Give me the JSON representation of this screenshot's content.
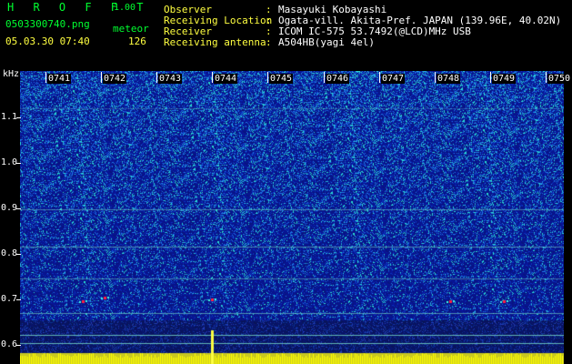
{
  "header": {
    "app_title": "H R O F F T",
    "version": "1.00",
    "filename": "0503300740.png",
    "mode_label": "meteor",
    "datetime": "05.03.30 07:40",
    "count": "126"
  },
  "station": [
    {
      "key": "Observer",
      "value": "Masayuki Kobayashi"
    },
    {
      "key": "Receiving Location",
      "value": "Ogata-vill. Akita-Pref. JAPAN (139.96E, 40.02N)"
    },
    {
      "key": "Receiver",
      "value": "ICOM IC-575 53.7492(@LCD)MHz USB"
    },
    {
      "key": "Receiving antenna",
      "value": "A504HB(yagi 4el)"
    }
  ],
  "separator": ":",
  "axis": {
    "y_unit": "kHz",
    "y_ticks": [
      "1.1",
      "1.0",
      "0.9",
      "0.8",
      "0.7",
      "0.6"
    ],
    "time_ticks": [
      "0741",
      "0742",
      "0743",
      "0744",
      "0745",
      "0746",
      "0747",
      "0748",
      "0749",
      "0750"
    ]
  },
  "colors": {
    "background": "#000000",
    "spectrum_base": "#0a1a9a",
    "noise_cyan": "#20d0d0",
    "header_green": "#00ff30",
    "header_yellow": "#ffff40",
    "signal_yellow": "#ffff00",
    "meteor_red": "#ff2040"
  }
}
